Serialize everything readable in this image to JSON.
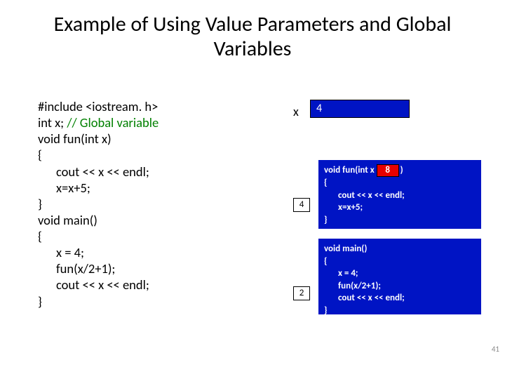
{
  "title": "Example of Using Value Parameters and Global Variables",
  "code": {
    "l1a": "#include <iostream. h>",
    "l2a": "int x; ",
    "l2b": "// Global variable",
    "l3": "void fun(int x)",
    "l4": "{",
    "l5": "cout << x << endl;",
    "l6": "x=x+5;",
    "l7": "}",
    "l8": "void main()",
    "l9": "{",
    "l10": "x = 4;",
    "l11": "fun(x/2+1);",
    "l12": "cout << x << endl;",
    "l13": "}"
  },
  "global_x": {
    "label": "x",
    "value": "4"
  },
  "fun_box": {
    "header_prefix": "void fun(int x",
    "param_value": "8",
    "header_suffix": ")",
    "open": "{",
    "body1": "cout << x << endl;",
    "body2": "x=x+5;",
    "close": "}"
  },
  "main_box": {
    "header": "void main()",
    "open": "{",
    "body1": "x = 4;",
    "body2": "fun(x/2+1);",
    "body3": "cout << x << endl;",
    "close": "}"
  },
  "flying": {
    "four": "4",
    "two": "2"
  },
  "page_number": "41"
}
